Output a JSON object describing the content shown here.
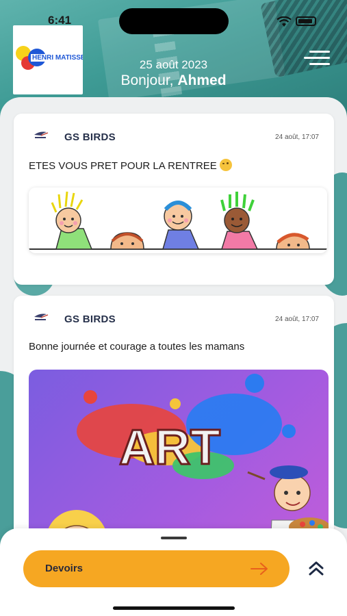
{
  "status_bar": {
    "time": "6:41"
  },
  "header": {
    "logo_text": "HENRI MATISSE",
    "date": "25 août 2023",
    "greeting_prefix": "Bonjour,",
    "user_name": "Ahmed"
  },
  "posts": [
    {
      "author": "GS BIRDS",
      "time": "24 août, 17:07",
      "text": "ETES VOUS PRET POUR LA RENTREE"
    },
    {
      "author": "GS BIRDS",
      "time": "24 août, 17:07",
      "text": "Bonne journée et courage a toutes les mamans",
      "image_word": "ART"
    }
  ],
  "bottom_bar": {
    "devoirs_label": "Devoirs"
  },
  "colors": {
    "teal": "#3d9a96",
    "accent_orange": "#f6a722",
    "card_bg": "#ffffff",
    "author_text": "#26304a"
  },
  "icons": [
    "menu-icon",
    "wifi-icon",
    "battery-icon",
    "arrow-right-icon",
    "double-chevron-up-icon",
    "bird-logo-icon"
  ]
}
